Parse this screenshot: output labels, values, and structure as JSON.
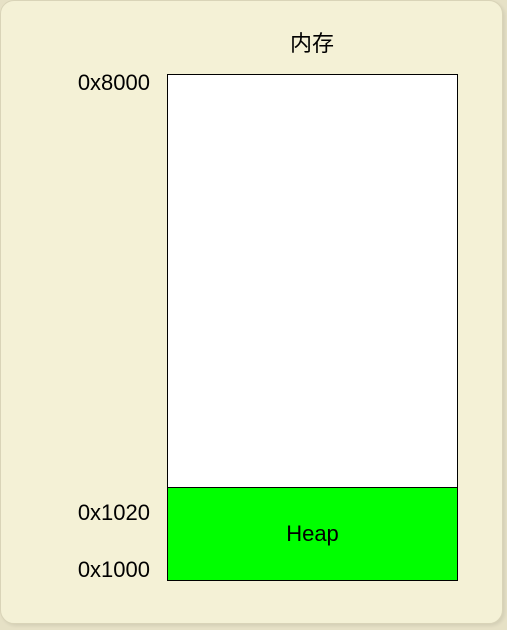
{
  "diagram": {
    "title": "内存",
    "regions": [
      {
        "label": "Heap",
        "color": "#00ff00"
      }
    ],
    "addresses": {
      "top": "0x8000",
      "heap_top": "0x1020",
      "bottom": "0x1000"
    },
    "colors": {
      "panel_background": "#f4f1d6",
      "memory_background": "#ffffff",
      "heap": "#00ff00"
    }
  }
}
